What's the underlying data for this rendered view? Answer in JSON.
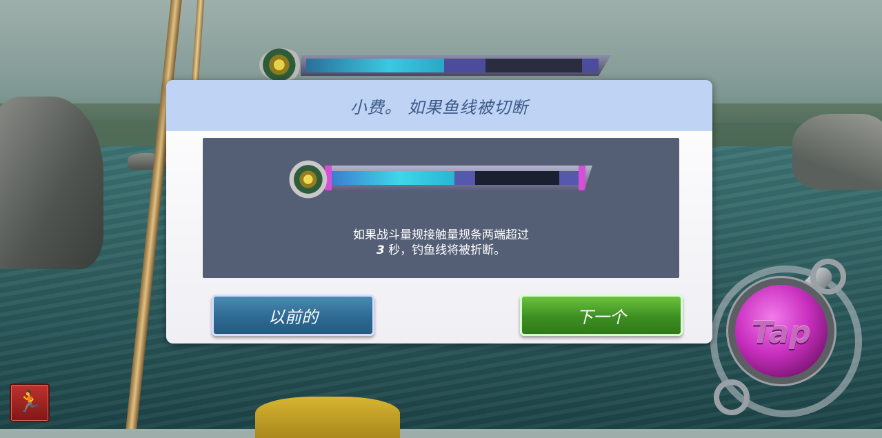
{
  "dialog": {
    "title": "小费。 如果鱼线被切断",
    "body_line1": "如果战斗量规接触量规条两端超过",
    "body_seconds": "3",
    "body_line2": " 秒，钓鱼线将被折断。",
    "prev_label": "以前的",
    "next_label": "下一个"
  },
  "controls": {
    "tap_label": "Tap"
  },
  "icons": {
    "exit": "running-man-icon",
    "reel": "fishing-reel-icon"
  },
  "colors": {
    "header_bg": "#bfd3f5",
    "panel_bg": "#545f76",
    "prev_button": "#2e6a93",
    "next_button": "#3d8f22",
    "tap_button": "#c92fbf"
  }
}
